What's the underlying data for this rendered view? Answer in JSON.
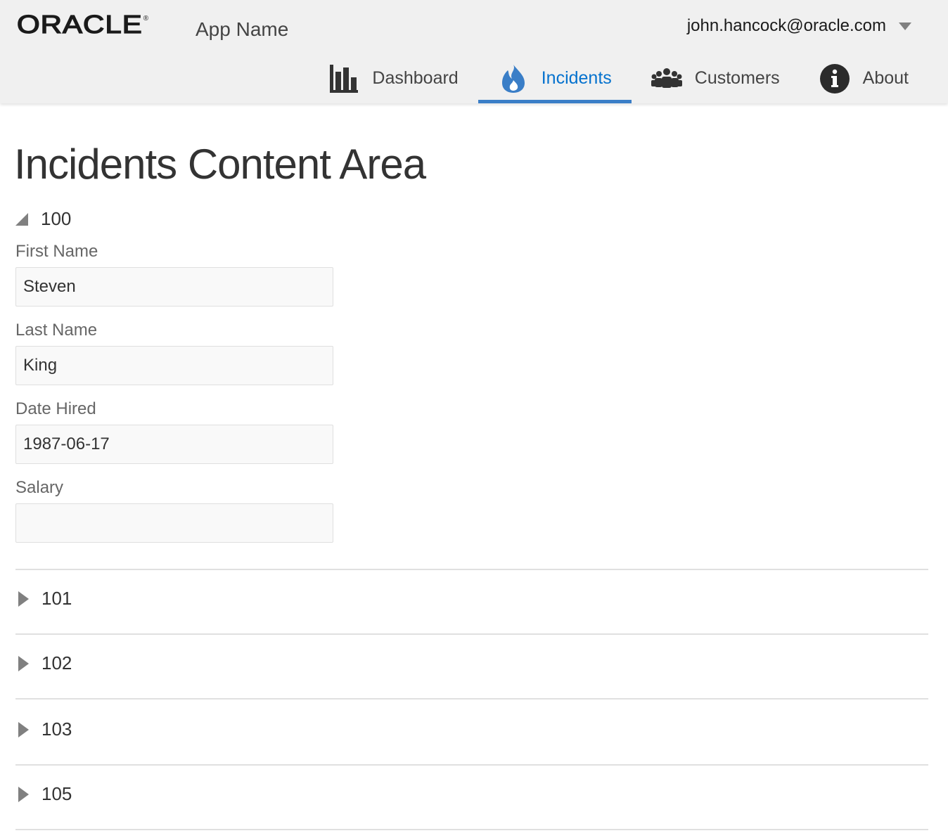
{
  "header": {
    "logo_text": "ORACLE",
    "logo_reg": "®",
    "app_name": "App Name",
    "user_email": "john.hancock@oracle.com"
  },
  "nav": {
    "items": [
      {
        "label": "Dashboard",
        "icon": "bar-chart-icon",
        "active": false
      },
      {
        "label": "Incidents",
        "icon": "fire-icon",
        "active": true
      },
      {
        "label": "Customers",
        "icon": "people-icon",
        "active": false
      },
      {
        "label": "About",
        "icon": "info-icon",
        "active": false
      }
    ],
    "active_color": "#0572ce"
  },
  "main": {
    "title": "Incidents Content Area",
    "panels": [
      {
        "id": "100",
        "expanded": true,
        "fields": [
          {
            "label": "First Name",
            "value": "Steven"
          },
          {
            "label": "Last Name",
            "value": "King"
          },
          {
            "label": "Date Hired",
            "value": "1987-06-17"
          },
          {
            "label": "Salary",
            "value": ""
          }
        ]
      },
      {
        "id": "101",
        "expanded": false
      },
      {
        "id": "102",
        "expanded": false
      },
      {
        "id": "103",
        "expanded": false
      },
      {
        "id": "105",
        "expanded": false
      }
    ]
  }
}
